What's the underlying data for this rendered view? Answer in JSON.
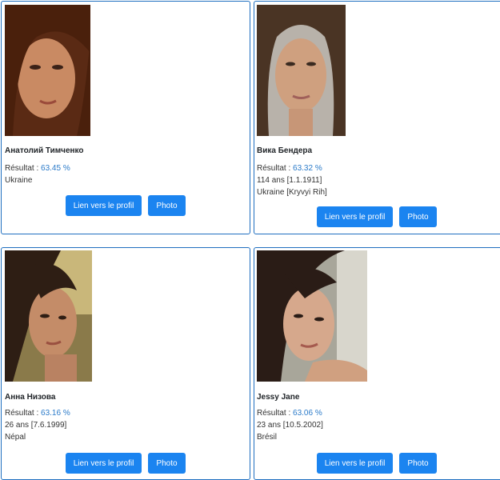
{
  "colors": {
    "card_border": "#1f6fc0",
    "button_bg": "#1b84f0",
    "score": "#2a7ac9"
  },
  "labels": {
    "result_prefix": "Résultat : ",
    "profile_button": "Lien vers le profil",
    "photo_button": "Photo"
  },
  "cards": [
    {
      "name": "Анатолий Тимченко",
      "score": "63.45 %",
      "age": "",
      "country": "Ukraine"
    },
    {
      "name": "Вика Бендера",
      "score": "63.32 %",
      "age": "114 ans [1.1.1911]",
      "country": "Ukraine [Kryvyi Rih]"
    },
    {
      "name": "Анна Низова",
      "score": "63.16 %",
      "age": "26 ans [7.6.1999]",
      "country": "Népal"
    },
    {
      "name": "Jessy Jane",
      "score": "63.06 %",
      "age": "23 ans [10.5.2002]",
      "country": "Brésil"
    }
  ]
}
